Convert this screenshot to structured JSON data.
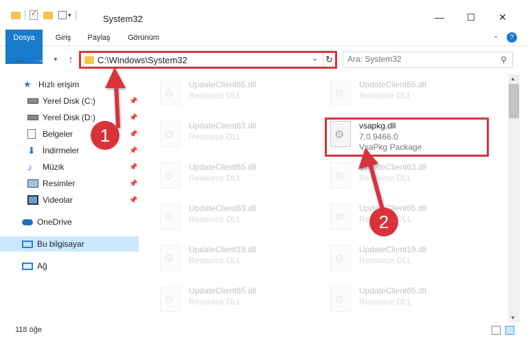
{
  "window": {
    "title": "System32",
    "buttons": {
      "minimize": "—",
      "maximize": "☐",
      "close": "✕"
    }
  },
  "ribbon": {
    "tabs": [
      {
        "label": "Dosya"
      },
      {
        "label": "Giriş"
      },
      {
        "label": "Paylaş"
      },
      {
        "label": "Görünüm"
      }
    ]
  },
  "address_bar": {
    "path": "C:\\Windows\\System32"
  },
  "search": {
    "placeholder": "Ara: System32"
  },
  "sidebar": {
    "quick_access": "Hızlı erişim",
    "items": [
      {
        "label": "Yerel Disk (C:)",
        "icon": "drive-icon"
      },
      {
        "label": "Yerel Disk (D:)",
        "icon": "drive-icon"
      },
      {
        "label": "Belgeler",
        "icon": "documents-icon"
      },
      {
        "label": "İndirmeler",
        "icon": "downloads-icon"
      },
      {
        "label": "Müzik",
        "icon": "music-icon"
      },
      {
        "label": "Resimler",
        "icon": "pictures-icon"
      },
      {
        "label": "Videolar",
        "icon": "videos-icon"
      }
    ],
    "onedrive": "OneDrive",
    "this_pc": "Bu bilgisayar",
    "network": "Ağ"
  },
  "files": {
    "left": [
      {
        "name": "UpdateClient65.dll",
        "desc": "Resource DLL"
      },
      {
        "name": "UpdateClient63.dll",
        "desc": "Resource DLL"
      },
      {
        "name": "UpdateClient65.dll",
        "desc": "Resource DLL"
      },
      {
        "name": "UpdateClient63.dll",
        "desc": "Resource DLL"
      },
      {
        "name": "UpdateClient19.dll",
        "desc": "Resource DLL"
      },
      {
        "name": "UpdateClient65.dll",
        "desc": "Resource DLL"
      }
    ],
    "right": [
      {
        "name": "UpdateClient65.dll",
        "desc": "Resource DLL"
      },
      {
        "name": "UpdateClient63.dll",
        "desc": "Resource DLL"
      },
      {
        "name": "UpdateClient65.dll",
        "desc": "Resource DLL"
      },
      {
        "name": "UpdateClient19.dll",
        "desc": "Resource DLL"
      },
      {
        "name": "UpdateClient65.dll",
        "desc": "Resource DLL"
      }
    ],
    "highlighted": {
      "name": "vsapkg.dll",
      "version": "7.0.9466.0",
      "description": "VsaPkg Package"
    }
  },
  "annotations": {
    "step1": "1",
    "step2": "2",
    "color": "#d9323a"
  },
  "status_bar": {
    "item_count": "118 öğe"
  },
  "colors": {
    "file_tab": "#1979ca",
    "selected": "#cce8ff",
    "highlight": "#d9323a"
  }
}
